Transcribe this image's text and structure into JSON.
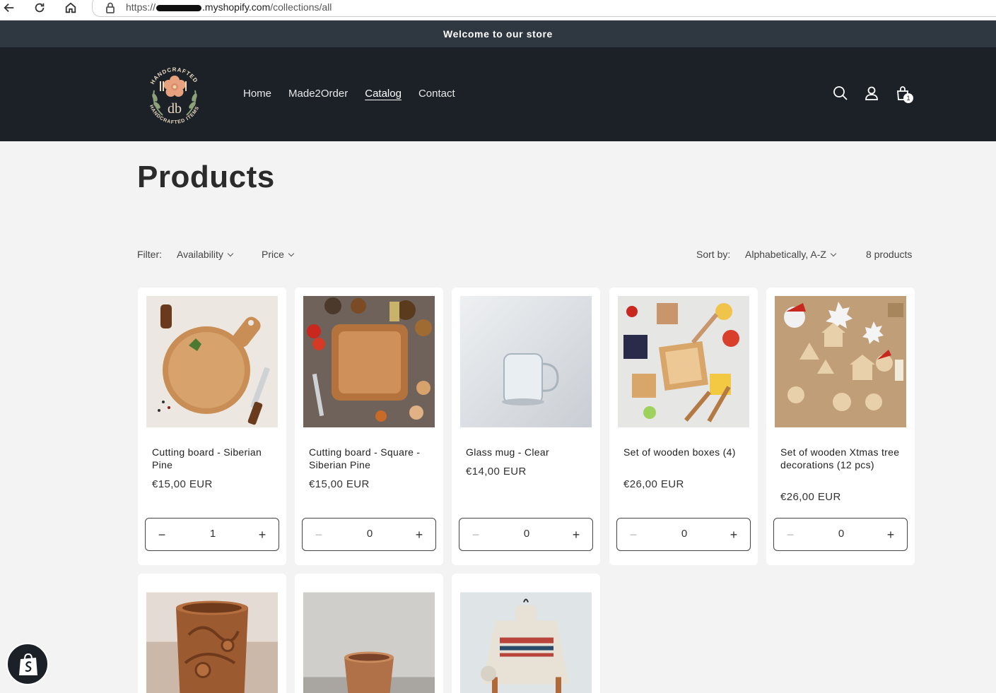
{
  "browser": {
    "url_prefix": "https://",
    "url_domain": ".myshopify.com",
    "url_path": "/collections/all"
  },
  "announcement": "Welcome to our store",
  "header": {
    "logo_top_text": "HANDCRAFTED",
    "logo_bottom_text": "HANDCRAFTED ITEMS",
    "nav": [
      "Home",
      "Made2Order",
      "Catalog",
      "Contact"
    ],
    "active_nav": "Catalog",
    "cart_count": "1"
  },
  "page": {
    "title": "Products",
    "filter_label": "Filter:",
    "filter_availability": "Availability",
    "filter_price": "Price",
    "sort_label": "Sort by:",
    "sort_value": "Alphabetically, A-Z",
    "count": "8 products"
  },
  "products": [
    {
      "name": "Cutting board - Siberian Pine",
      "price": "€15,00 EUR",
      "qty": "1"
    },
    {
      "name": "Cutting board - Square - Siberian Pine",
      "price": "€15,00 EUR",
      "qty": "0"
    },
    {
      "name": "Glass mug - Clear",
      "price": "€14,00 EUR",
      "qty": "0"
    },
    {
      "name": "Set of wooden boxes (4)",
      "price": "€26,00 EUR",
      "qty": "0"
    },
    {
      "name": "Set of wooden Xtmas tree decorations (12 pcs)",
      "price": "€26,00 EUR",
      "qty": "0"
    }
  ],
  "qty_controls": {
    "minus": "−",
    "plus": "+"
  }
}
